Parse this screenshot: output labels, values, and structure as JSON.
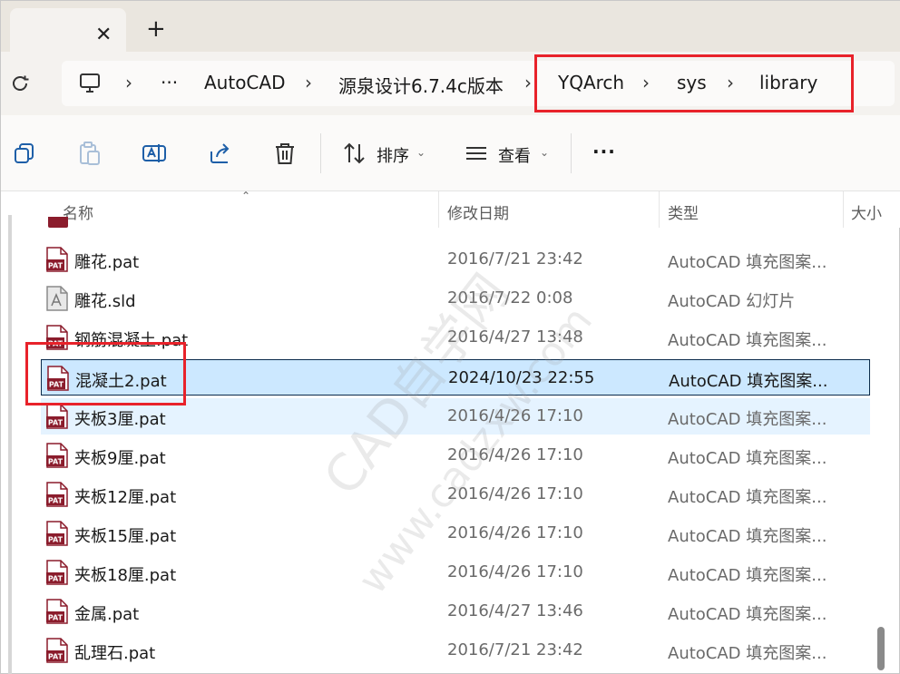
{
  "tab": {
    "close_glyph": "✕",
    "new_glyph": "+"
  },
  "address": {
    "refresh_icon": "refresh-icon",
    "computer_icon": "computer-icon",
    "ellipsis": "···",
    "crumbs": [
      "AutoCAD",
      "源泉设计6.7.4c版本",
      "YQArch",
      "sys",
      "library"
    ],
    "separator": "›"
  },
  "toolbar": {
    "sort_label": "排序",
    "view_label": "查看",
    "more_label": "···"
  },
  "columns": {
    "name": "名称",
    "date": "修改日期",
    "type": "类型",
    "size": "大小"
  },
  "files": [
    {
      "name": "雕花.pat",
      "date": "2016/7/21 23:42",
      "type": "AutoCAD 填充图案...",
      "icon": "pat"
    },
    {
      "name": "雕花.sld",
      "date": "2016/7/22 0:08",
      "type": "AutoCAD 幻灯片",
      "icon": "sld"
    },
    {
      "name": "钢筋混凝土.pat",
      "date": "2016/4/27 13:48",
      "type": "AutoCAD 填充图案...",
      "icon": "pat"
    },
    {
      "name": "混凝土2.pat",
      "date": "2024/10/23 22:55",
      "type": "AutoCAD 填充图案...",
      "icon": "pat"
    },
    {
      "name": "夹板3厘.pat",
      "date": "2016/4/26 17:10",
      "type": "AutoCAD 填充图案...",
      "icon": "pat"
    },
    {
      "name": "夹板9厘.pat",
      "date": "2016/4/26 17:10",
      "type": "AutoCAD 填充图案...",
      "icon": "pat"
    },
    {
      "name": "夹板12厘.pat",
      "date": "2016/4/26 17:10",
      "type": "AutoCAD 填充图案...",
      "icon": "pat"
    },
    {
      "name": "夹板15厘.pat",
      "date": "2016/4/26 17:10",
      "type": "AutoCAD 填充图案...",
      "icon": "pat"
    },
    {
      "name": "夹板18厘.pat",
      "date": "2016/4/26 17:10",
      "type": "AutoCAD 填充图案...",
      "icon": "pat"
    },
    {
      "name": "金属.pat",
      "date": "2016/4/27 13:46",
      "type": "AutoCAD 填充图案...",
      "icon": "pat"
    },
    {
      "name": "乱理石.pat",
      "date": "2016/7/21 23:42",
      "type": "AutoCAD 填充图案...",
      "icon": "pat"
    }
  ],
  "pat_icon_text": "PAT",
  "watermark": {
    "line1": "CAD自学网",
    "line2": "www.cadzxw.com"
  },
  "colors": {
    "accent_red": "#e8222a",
    "selected_bg": "#cce8ff",
    "hover_bg": "#e5f3ff",
    "pat_icon": "#8b1c2c"
  }
}
